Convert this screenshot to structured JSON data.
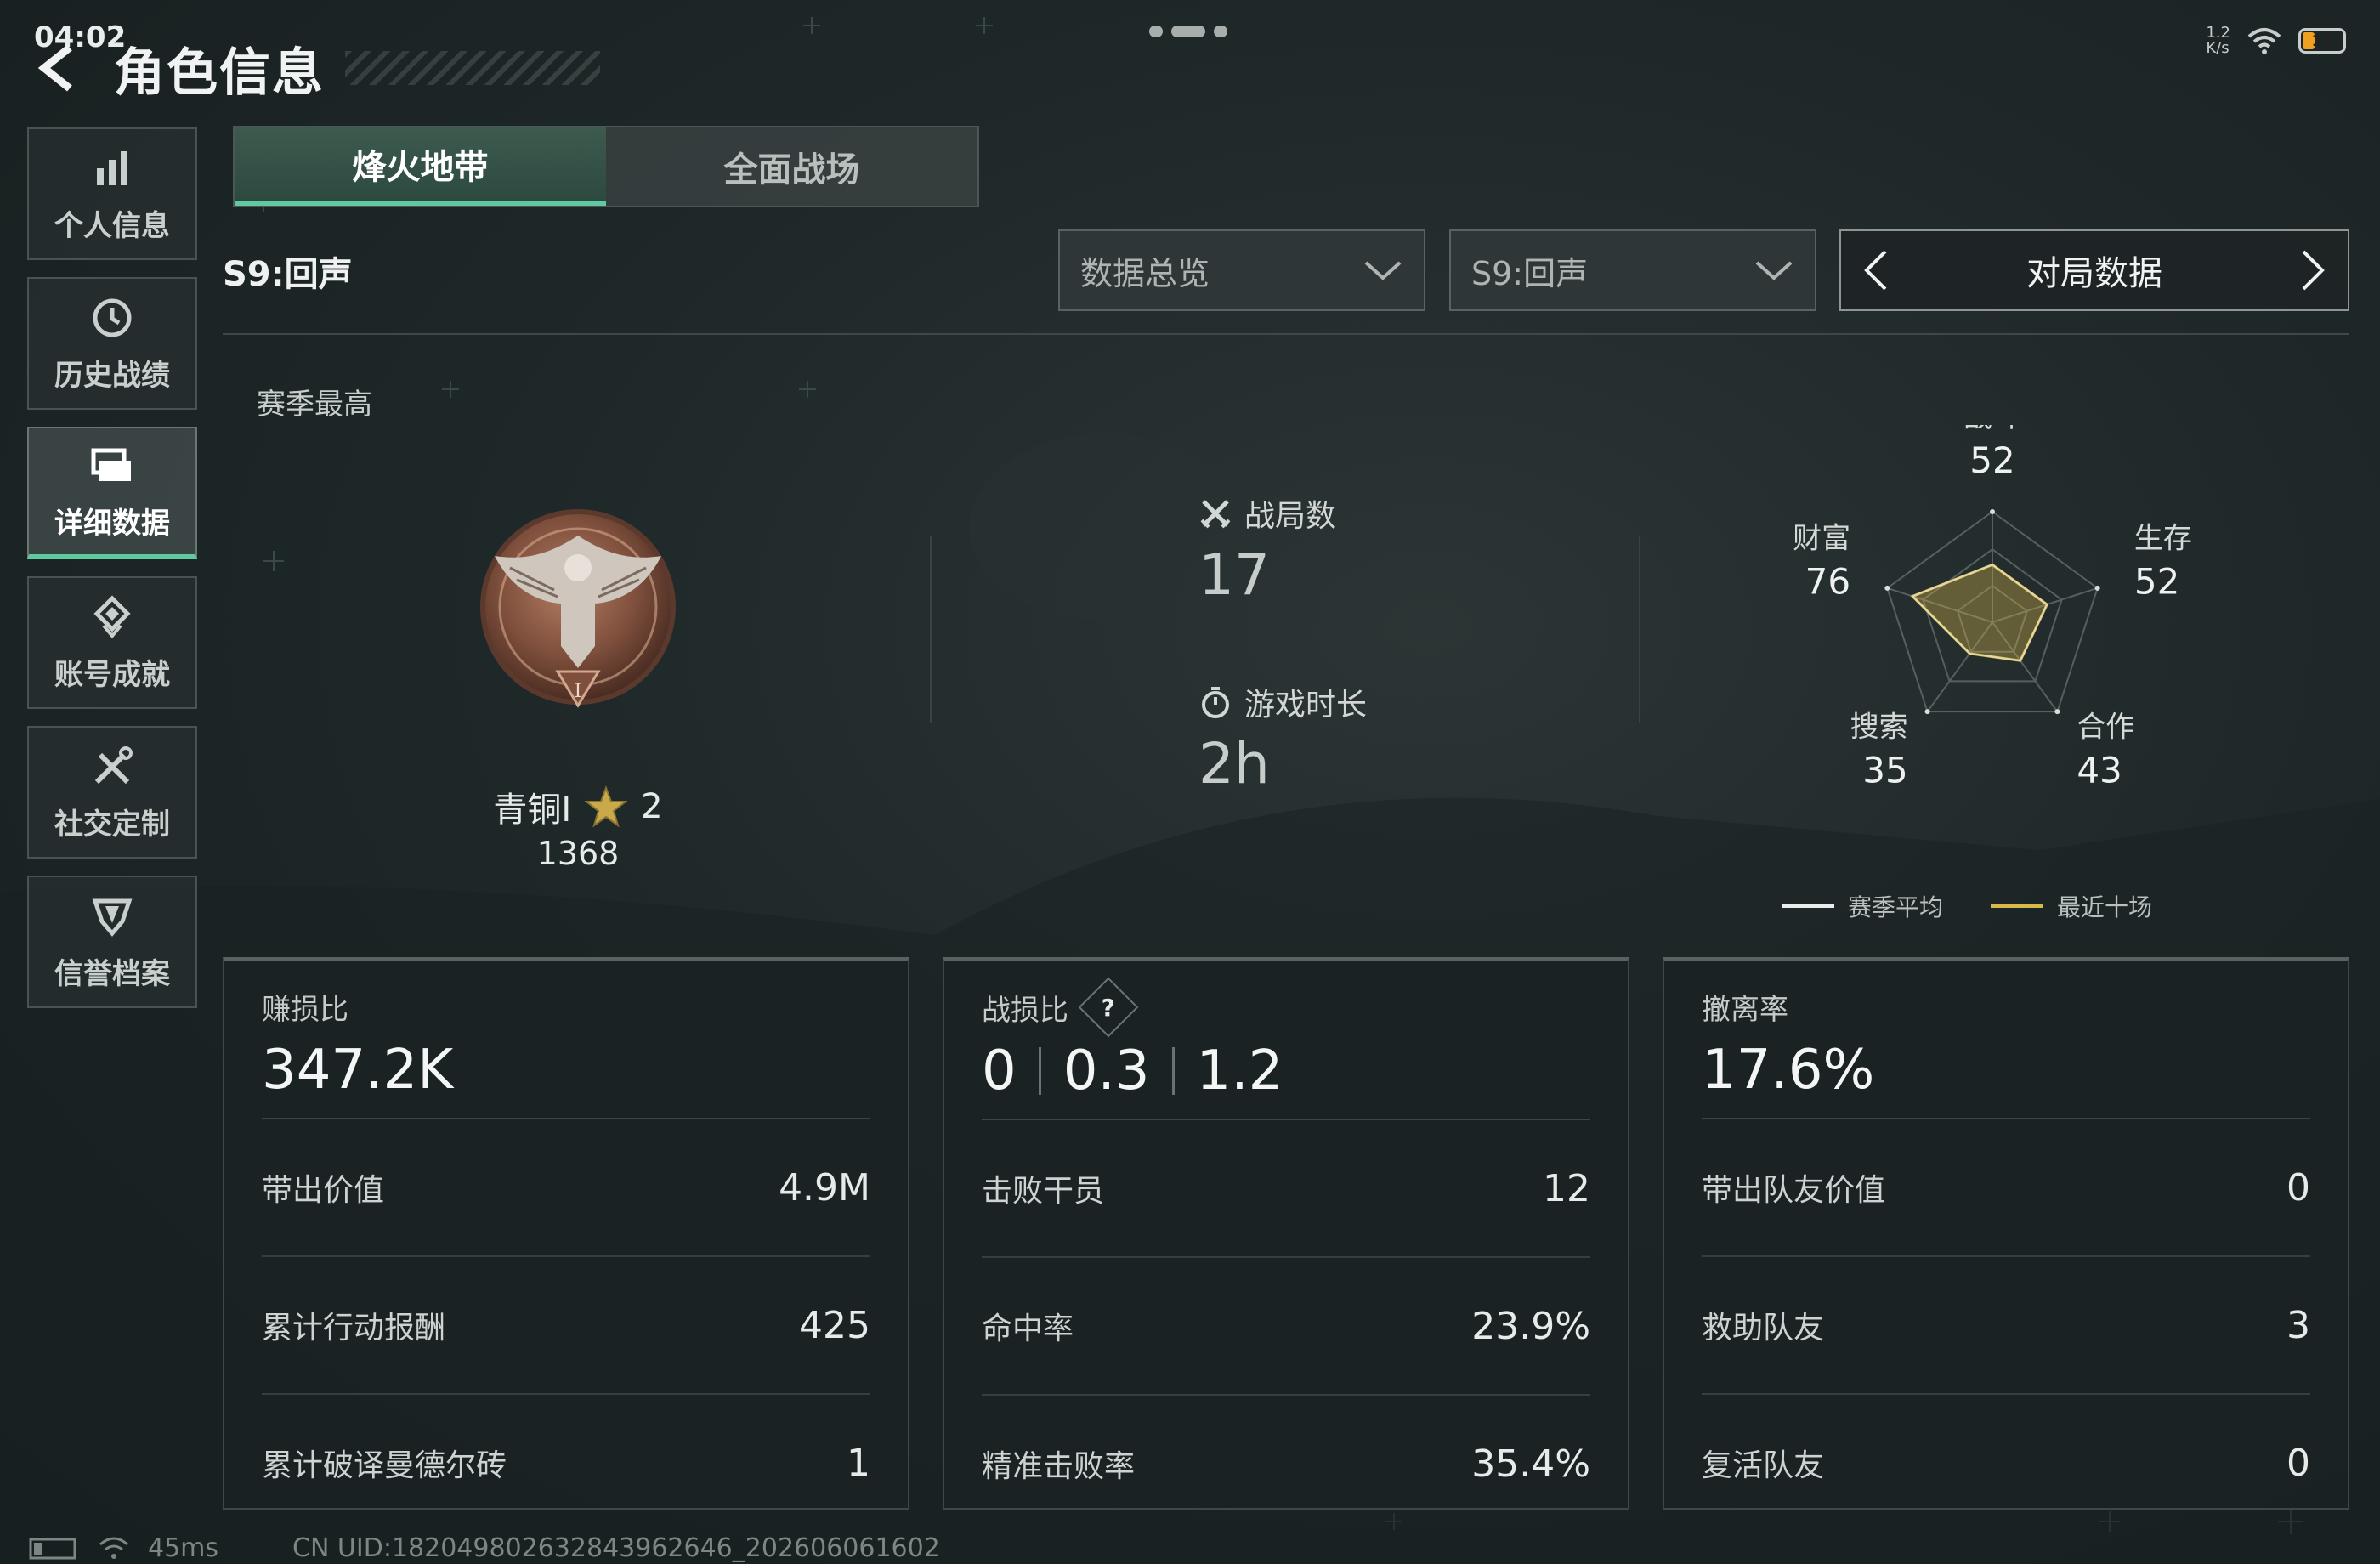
{
  "status": {
    "time": "04:02",
    "net_speed": "1.2\nK/s",
    "battery": "15"
  },
  "header": {
    "title": "角色信息"
  },
  "sidebar": {
    "items": [
      {
        "label": "个人信息",
        "icon": "bar-chart-icon"
      },
      {
        "label": "历史战绩",
        "icon": "history-clock-icon"
      },
      {
        "label": "详细数据",
        "icon": "folder-icon",
        "active": true
      },
      {
        "label": "账号成就",
        "icon": "achievement-icon"
      },
      {
        "label": "社交定制",
        "icon": "tools-icon"
      },
      {
        "label": "信誉档案",
        "icon": "shield-icon"
      }
    ]
  },
  "tabs": [
    {
      "label": "烽火地带",
      "active": true
    },
    {
      "label": "全面战场",
      "active": false
    }
  ],
  "filters": {
    "season_label": "S9:回声",
    "dropdown_overview": "数据总览",
    "dropdown_season": "S9:回声",
    "pager_label": "对局数据"
  },
  "overview": {
    "season_best_label": "赛季最高",
    "rank_name": "青铜I",
    "rank_stars": "2",
    "rank_score": "1368",
    "matches_label": "战局数",
    "matches_value": "17",
    "playtime_label": "游戏时长",
    "playtime_value": "2h"
  },
  "radar": {
    "axes": [
      {
        "name": "战斗",
        "value": "52"
      },
      {
        "name": "生存",
        "value": "52"
      },
      {
        "name": "合作",
        "value": "43"
      },
      {
        "name": "搜索",
        "value": "35"
      },
      {
        "name": "财富",
        "value": "76"
      }
    ],
    "legend_avg": "赛季平均",
    "legend_recent": "最近十场",
    "avg_color": "#e8ecea",
    "recent_color": "#d9b84a"
  },
  "cards": [
    {
      "title": "赚损比",
      "big": "347.2K",
      "rows": [
        {
          "label": "带出价值",
          "value": "4.9M"
        },
        {
          "label": "累计行动报酬",
          "value": "425"
        },
        {
          "label": "累计破译曼德尔砖",
          "value": "1"
        }
      ]
    },
    {
      "title": "战损比",
      "help": "?",
      "big_parts": [
        "0",
        "0.3",
        "1.2"
      ],
      "rows": [
        {
          "label": "击败干员",
          "value": "12"
        },
        {
          "label": "命中率",
          "value": "23.9%"
        },
        {
          "label": "精准击败率",
          "value": "35.4%"
        }
      ]
    },
    {
      "title": "撤离率",
      "big": "17.6%",
      "rows": [
        {
          "label": "带出队友价值",
          "value": "0"
        },
        {
          "label": "救助队友",
          "value": "3"
        },
        {
          "label": "复活队友",
          "value": "0"
        }
      ]
    }
  ],
  "footer": {
    "ping": "45ms",
    "uid": "CN UID:182049802632843962646_202606061602"
  },
  "colors": {
    "accent": "#5fc9a0",
    "gold": "#d9b84a"
  }
}
